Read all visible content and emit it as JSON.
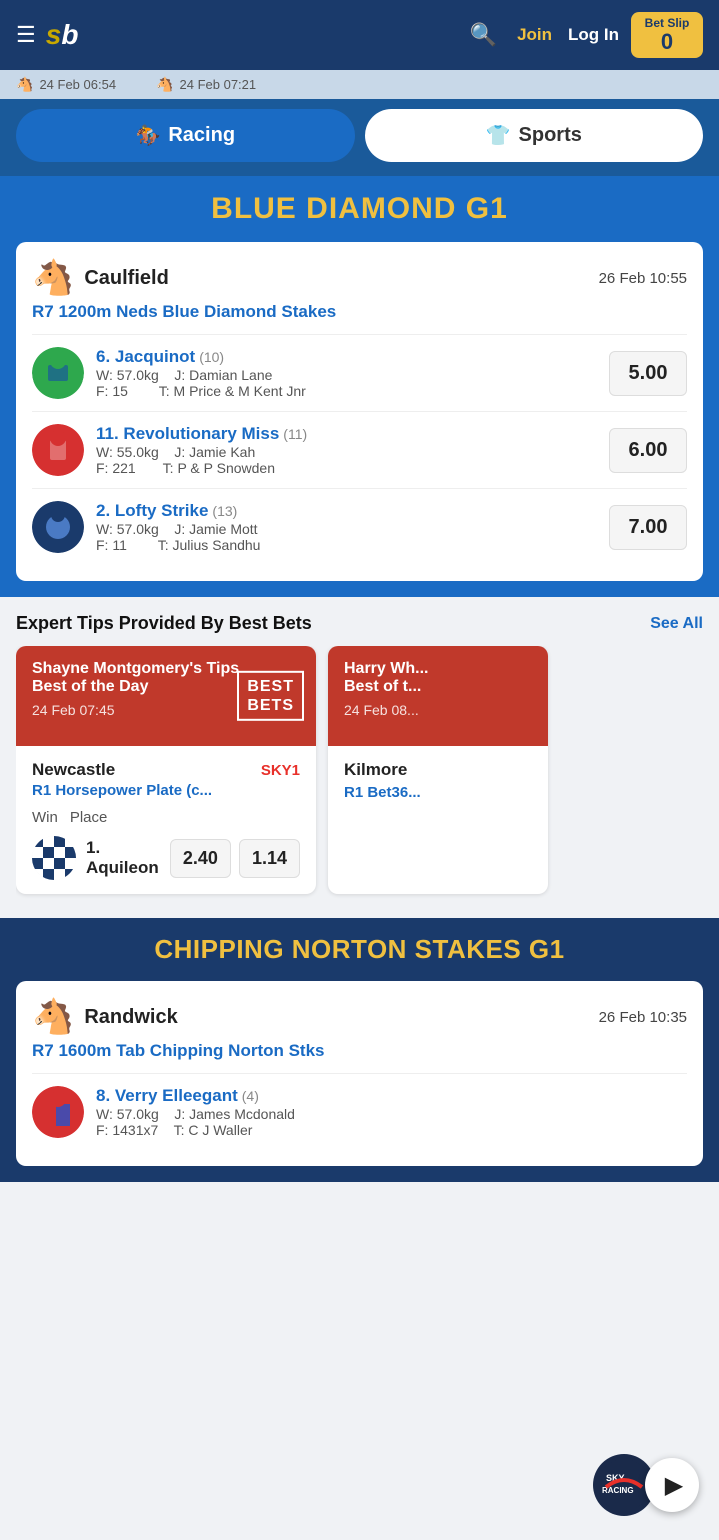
{
  "header": {
    "logo": "sb",
    "join_label": "Join",
    "login_label": "Log In",
    "betslip_label": "Bet Slip",
    "betslip_count": "0"
  },
  "time_bar": {
    "items": [
      {
        "time": "24 Feb 06:54"
      },
      {
        "time": "24 Feb 07:21"
      }
    ]
  },
  "tabs": {
    "racing_label": "Racing",
    "sports_label": "Sports"
  },
  "blue_diamond": {
    "title": "BLUE DIAMOND G1",
    "venue": "Caulfield",
    "time": "26 Feb 10:55",
    "race": "R7 1200m Neds Blue Diamond Stakes",
    "runners": [
      {
        "number": "6.",
        "name": "Jacquinot",
        "barrier": "(10)",
        "weight": "W: 57.0kg",
        "jockey": "J: Damian Lane",
        "form": "F: 15",
        "trainer": "T: M Price & M Kent Jnr",
        "odds": "5.00",
        "silks_color": "green"
      },
      {
        "number": "11.",
        "name": "Revolutionary Miss",
        "barrier": "(11)",
        "weight": "W: 55.0kg",
        "jockey": "J: Jamie Kah",
        "form": "F: 221",
        "trainer": "T: P & P Snowden",
        "odds": "6.00",
        "silks_color": "red"
      },
      {
        "number": "2.",
        "name": "Lofty Strike",
        "barrier": "(13)",
        "weight": "W: 57.0kg",
        "jockey": "J: Jamie Mott",
        "form": "F: 11",
        "trainer": "T: Julius Sandhu",
        "odds": "7.00",
        "silks_color": "navy"
      }
    ]
  },
  "expert_tips": {
    "title": "Expert Tips Provided By Best Bets",
    "see_all": "See All",
    "cards": [
      {
        "tipster": "Shayne Montgomery's Tips",
        "tip_type": "Best of the Day",
        "date": "24 Feb 07:45",
        "logo": "BEST\nBETS",
        "venue": "Newcastle",
        "sky": "SKY1",
        "race": "R1 Horsepower Plate (c...",
        "win_label": "Win",
        "place_label": "Place",
        "runner_number": "1.",
        "runner_name": "Aquileon",
        "win_odds": "2.40",
        "place_odds": "1.14"
      },
      {
        "tipster": "Harry Wh...",
        "tip_type": "Best of t...",
        "date": "24 Feb 08...",
        "venue": "Kilmore",
        "race": "R1 Bet36..."
      }
    ]
  },
  "chipping_norton": {
    "title": "CHIPPING NORTON STAKES G1",
    "venue": "Randwick",
    "time": "26 Feb 10:35",
    "race": "R7 1600m Tab Chipping Norton Stks",
    "runners": [
      {
        "number": "8.",
        "name": "Verry Elleegant",
        "barrier": "(4)",
        "weight": "W: 57.0kg",
        "jockey": "J: James Mcdonald",
        "form": "F: 1431x7",
        "trainer": "T: C J Waller",
        "silks_color": "red"
      }
    ]
  }
}
